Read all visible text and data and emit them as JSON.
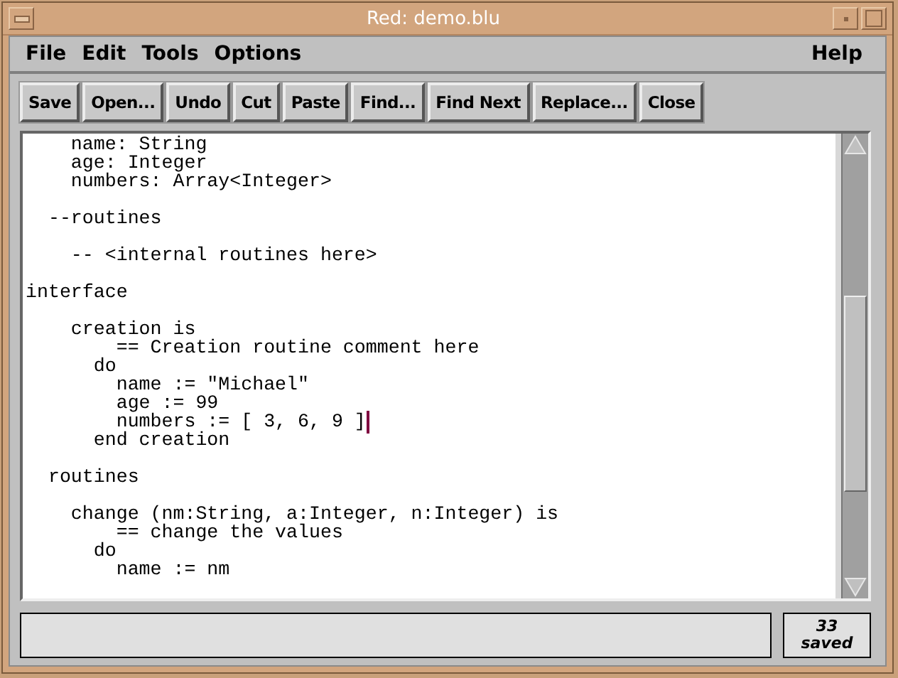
{
  "window": {
    "title": "Red: demo.blu"
  },
  "menu": [
    {
      "label": "File"
    },
    {
      "label": "Edit"
    },
    {
      "label": "Tools"
    },
    {
      "label": "Options"
    },
    {
      "label": "Help",
      "kind": "right"
    }
  ],
  "toolbar": [
    "Save",
    "Open...",
    "Undo",
    "Cut",
    "Paste",
    "Find...",
    "Find Next",
    "Replace...",
    "Close"
  ],
  "editor": {
    "lines": [
      {
        "text": "    name: String",
        "cursor": false
      },
      {
        "text": "    age: Integer",
        "cursor": false
      },
      {
        "text": "    numbers: Array<Integer>",
        "cursor": false
      },
      {
        "cursor": false
      },
      {
        "text": "  --routines",
        "cursor": false
      },
      {
        "cursor": false
      },
      {
        "text": "    -- <internal routines here>",
        "cursor": false
      },
      {
        "cursor": false
      },
      {
        "text": "interface",
        "cursor": false
      },
      {
        "cursor": false
      },
      {
        "text": "    creation is",
        "cursor": false
      },
      {
        "text": "        == Creation routine comment here",
        "cursor": false
      },
      {
        "text": "      do",
        "cursor": false
      },
      {
        "text": "        name := \"Michael\"",
        "cursor": false
      },
      {
        "text": "        age := 99",
        "cursor": false
      },
      {
        "text": "        numbers := [ 3, 6, 9 ]",
        "cursor": true
      },
      {
        "text": "      end creation",
        "cursor": false
      },
      {
        "cursor": false
      },
      {
        "text": "  routines",
        "cursor": false
      },
      {
        "cursor": false
      },
      {
        "text": "    change (nm:String, a:Integer, n:Integer) is",
        "cursor": false
      },
      {
        "text": "        == change the values",
        "cursor": false
      },
      {
        "text": "      do",
        "cursor": false
      },
      {
        "text": "        name := nm",
        "cursor": false
      }
    ]
  },
  "status_bar": {
    "count": "33",
    "state": "saved"
  }
}
